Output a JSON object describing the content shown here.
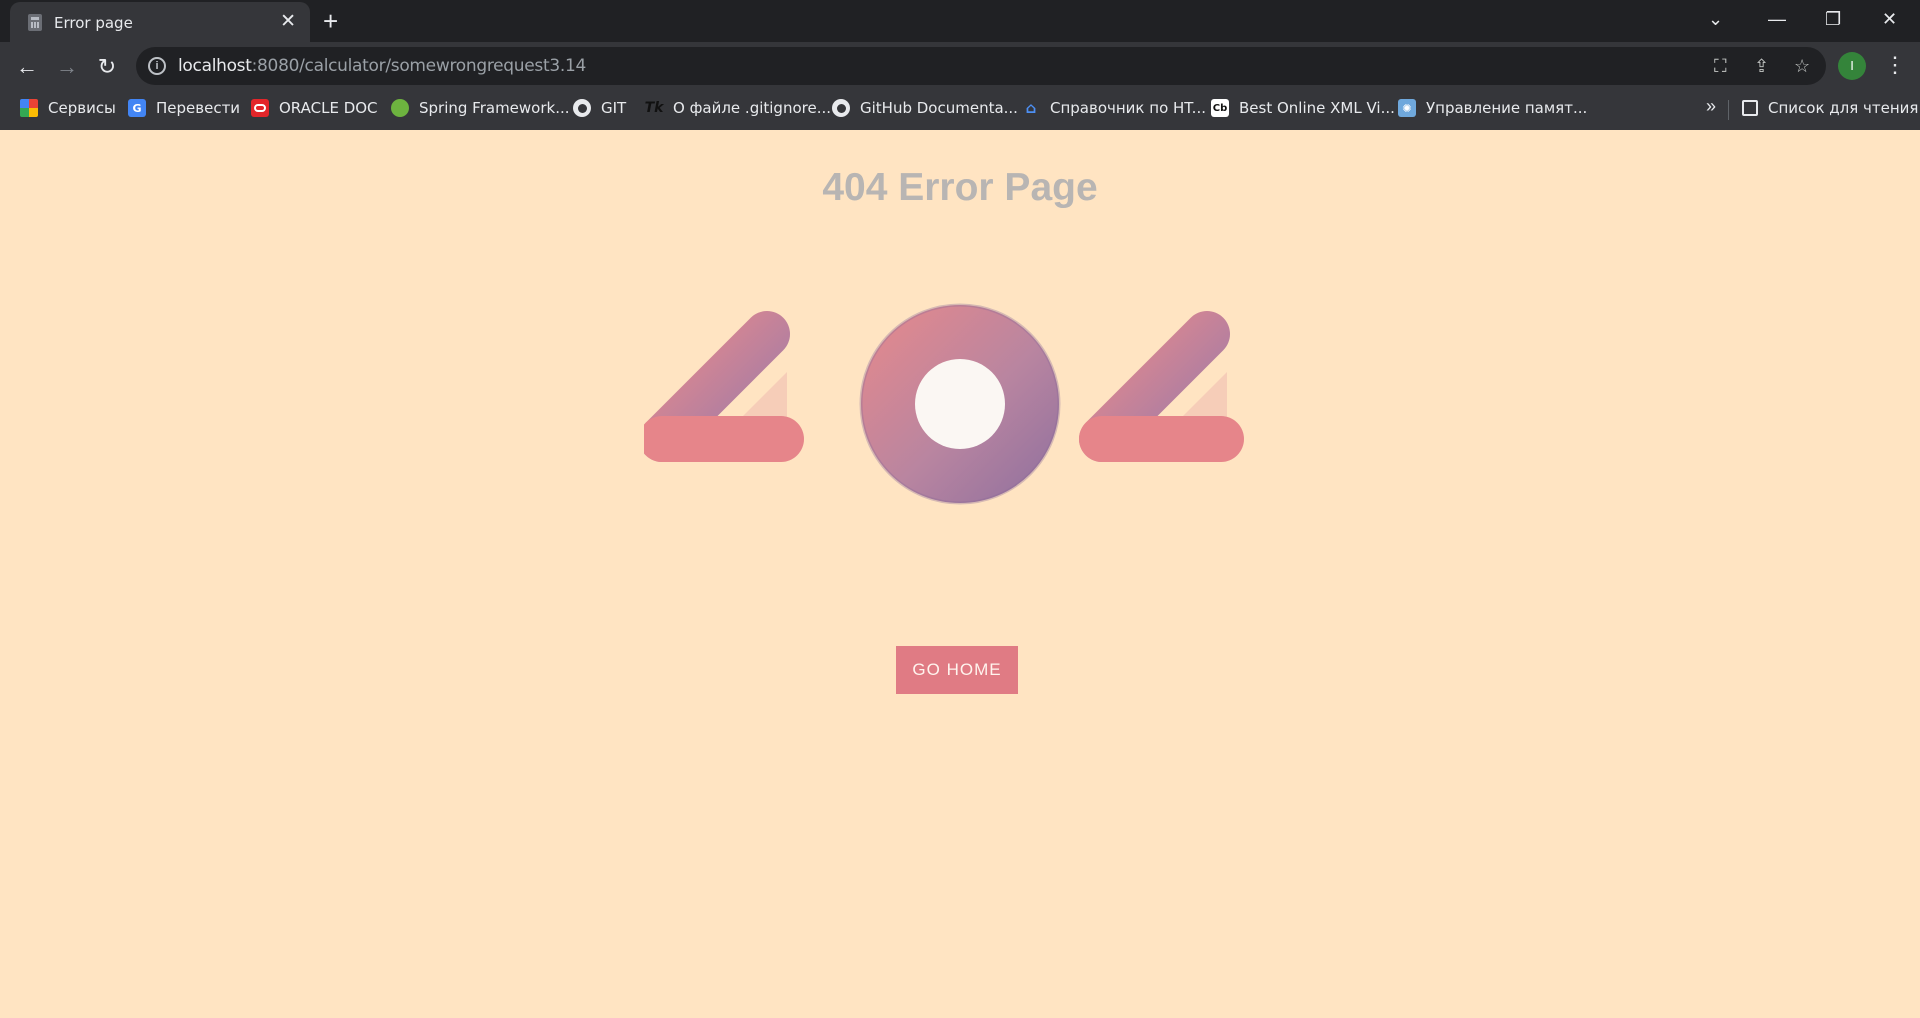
{
  "browser": {
    "tab": {
      "title": "Error page"
    },
    "address": {
      "host": "localhost",
      "path": ":8080/calculator/somewrongrequest3.14"
    },
    "profile_initial": "I",
    "bookmarks": [
      {
        "label": "Сервисы",
        "icon": "apps-grid-icon"
      },
      {
        "label": "Перевести",
        "icon": "google-translate-icon"
      },
      {
        "label": "ORACLE DOC",
        "icon": "oracle-icon"
      },
      {
        "label": "Spring Framework...",
        "icon": "spring-leaf-icon"
      },
      {
        "label": "GIT",
        "icon": "github-icon"
      },
      {
        "label": "О файле .gitignore...",
        "icon": "tk-icon"
      },
      {
        "label": "GitHub Documenta...",
        "icon": "github-icon"
      },
      {
        "label": "Справочник по HT...",
        "icon": "house-icon"
      },
      {
        "label": "Best Online XML Vi...",
        "icon": "cb-icon"
      },
      {
        "label": "Управление памят...",
        "icon": "gear-sparkle-icon"
      }
    ],
    "reading_list": "Список для чтения"
  },
  "page": {
    "title": "404 Error Page",
    "digits": [
      "4",
      "0",
      "4"
    ],
    "button_label": "GO HOME"
  },
  "colors": {
    "page_background": "#ffe4c2",
    "title_gray": "#b8b5b3",
    "button_pink": "#e07b84",
    "gradient_pink": "#e88a8c",
    "gradient_purple": "#9c7aa8"
  }
}
